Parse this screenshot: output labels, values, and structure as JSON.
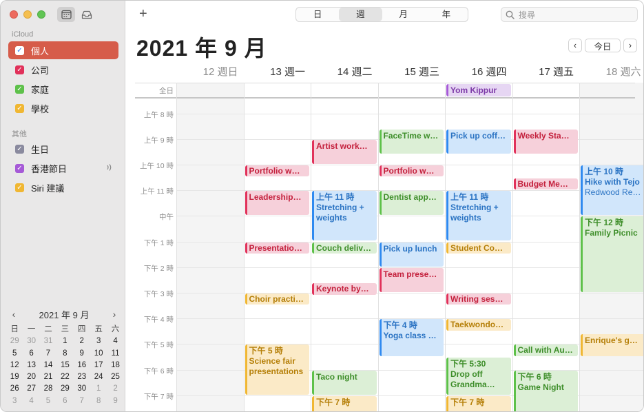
{
  "sidebar": {
    "icloud_label": "iCloud",
    "other_label": "其他",
    "calendars": [
      {
        "label": "個人",
        "color": "#2f7cf6",
        "selected": true
      },
      {
        "label": "公司",
        "color": "#e1315a"
      },
      {
        "label": "家庭",
        "color": "#5ec14a"
      },
      {
        "label": "學校",
        "color": "#f0b733"
      }
    ],
    "other_calendars": [
      {
        "label": "生日",
        "color": "#8a8a9e"
      },
      {
        "label": "香港節日",
        "color": "#a65ad7"
      },
      {
        "label": "Siri 建議",
        "color": "#f0b733"
      }
    ]
  },
  "mini_calendar": {
    "title": "2021 年 9 月",
    "prev": "‹",
    "next": "›",
    "weekdays": [
      "日",
      "一",
      "二",
      "三",
      "四",
      "五",
      "六"
    ],
    "days": [
      [
        "29",
        "30",
        "31",
        "1",
        "2",
        "3",
        "4"
      ],
      [
        "5",
        "6",
        "7",
        "8",
        "9",
        "10",
        "11"
      ],
      [
        "12",
        "13",
        "14",
        "15",
        "16",
        "17",
        "18"
      ],
      [
        "19",
        "20",
        "21",
        "22",
        "23",
        "24",
        "25"
      ],
      [
        "26",
        "27",
        "28",
        "29",
        "30",
        "1",
        "2"
      ],
      [
        "3",
        "4",
        "5",
        "6",
        "7",
        "8",
        "9"
      ]
    ]
  },
  "toolbar": {
    "add": "+",
    "views": [
      "日",
      "週",
      "月",
      "年"
    ],
    "active_view": "週",
    "search_placeholder": "搜尋"
  },
  "header": {
    "title": "2021 年 9 月",
    "prev": "‹",
    "today": "今日",
    "next": "›"
  },
  "week": {
    "days": [
      "12 週日",
      "13 週一",
      "14 週二",
      "15 週三",
      "16 週四",
      "17 週五",
      "18 週六"
    ],
    "allday_label": "全日",
    "time_labels": [
      "上午 8 時",
      "上午 9 時",
      "上午 10 時",
      "上午 11 時",
      "中午",
      "下午 1 時",
      "下午 2 時",
      "下午 3 時",
      "下午 4 時",
      "下午 5 時",
      "下午 6 時",
      "下午 7 時"
    ]
  },
  "allday_events": [
    {
      "day": 4,
      "name": "Yom Kippur",
      "color": "purple"
    }
  ],
  "events": [
    {
      "day": 1,
      "start": 10.0,
      "end": 10.5,
      "name": "Portfolio w…",
      "color": "red"
    },
    {
      "day": 1,
      "start": 11.0,
      "end": 12.0,
      "name": "Leadership…",
      "color": "red"
    },
    {
      "day": 1,
      "start": 13.0,
      "end": 13.5,
      "name": "Presentatio…",
      "color": "red"
    },
    {
      "day": 1,
      "start": 15.0,
      "end": 15.5,
      "name": "Choir practi…",
      "color": "yellow"
    },
    {
      "day": 1,
      "start": 17.0,
      "end": 19.0,
      "time": "下午 5 時",
      "name": "Science fair presentations",
      "color": "yellow",
      "wrap": true
    },
    {
      "day": 2,
      "start": 9.0,
      "end": 10.0,
      "name": "Artist work…",
      "color": "red"
    },
    {
      "day": 2,
      "start": 11.0,
      "end": 13.0,
      "time": "上午 11 時",
      "name": "Stretching + weights",
      "color": "blue",
      "wrap": true
    },
    {
      "day": 2,
      "start": 13.0,
      "end": 13.5,
      "name": "Couch deliv…",
      "color": "green"
    },
    {
      "day": 2,
      "start": 14.6,
      "end": 15.1,
      "name": "Keynote by…",
      "color": "red"
    },
    {
      "day": 2,
      "start": 18.0,
      "end": 19.0,
      "name": "Taco night",
      "color": "green"
    },
    {
      "day": 2,
      "start": 19.0,
      "end": 20.0,
      "time": "下午 7 時",
      "name": "",
      "color": "yellow"
    },
    {
      "day": 3,
      "start": 8.6,
      "end": 9.6,
      "name": "FaceTime w…",
      "color": "green"
    },
    {
      "day": 3,
      "start": 10.0,
      "end": 10.5,
      "name": "Portfolio w…",
      "color": "red"
    },
    {
      "day": 3,
      "start": 11.0,
      "end": 12.0,
      "name": "Dentist app…",
      "color": "green"
    },
    {
      "day": 3,
      "start": 13.0,
      "end": 14.0,
      "name": "Pick up lunch",
      "color": "blue"
    },
    {
      "day": 3,
      "start": 14.0,
      "end": 15.0,
      "name": "Team prese…",
      "color": "red"
    },
    {
      "day": 3,
      "start": 16.0,
      "end": 17.5,
      "time": "下午 4 時",
      "name": "Yoga class  …",
      "color": "blue"
    },
    {
      "day": 4,
      "start": 8.6,
      "end": 9.6,
      "name": "Pick up coff…",
      "color": "blue"
    },
    {
      "day": 4,
      "start": 11.0,
      "end": 13.0,
      "time": "上午 11 時",
      "name": "Stretching + weights",
      "color": "blue",
      "wrap": true
    },
    {
      "day": 4,
      "start": 13.0,
      "end": 13.5,
      "name": "Student Co…",
      "color": "yellow"
    },
    {
      "day": 4,
      "start": 15.0,
      "end": 15.5,
      "name": "Writing ses…",
      "color": "red"
    },
    {
      "day": 4,
      "start": 16.0,
      "end": 16.5,
      "name": "Taekwondo…",
      "color": "yellow"
    },
    {
      "day": 4,
      "start": 17.5,
      "end": 19.0,
      "time": "下午 5:30",
      "name": "Drop off Grandma…",
      "color": "green",
      "wrap": true
    },
    {
      "day": 4,
      "start": 19.0,
      "end": 20.0,
      "time": "下午 7 時",
      "name": "",
      "color": "yellow"
    },
    {
      "day": 5,
      "start": 8.6,
      "end": 9.6,
      "name": "Weekly Sta…",
      "color": "red"
    },
    {
      "day": 5,
      "start": 10.5,
      "end": 11.0,
      "name": "Budget Me…",
      "color": "red"
    },
    {
      "day": 5,
      "start": 17.0,
      "end": 17.5,
      "name": "Call with Au…",
      "color": "green"
    },
    {
      "day": 5,
      "start": 18.0,
      "end": 20.0,
      "time": "下午 6 時",
      "name": "Game Night",
      "color": "green"
    },
    {
      "day": 6,
      "start": 10.0,
      "end": 12.0,
      "time": "上午 10 時",
      "name": "Hike with Tejo",
      "location": "Redwood Re…",
      "color": "blue",
      "wrap": true
    },
    {
      "day": 6,
      "start": 12.0,
      "end": 15.0,
      "time": "下午 12 時",
      "name": "Family Picnic",
      "color": "green"
    },
    {
      "day": 6,
      "start": 16.6,
      "end": 17.5,
      "name": "Enrique's g…",
      "color": "yellow"
    }
  ]
}
